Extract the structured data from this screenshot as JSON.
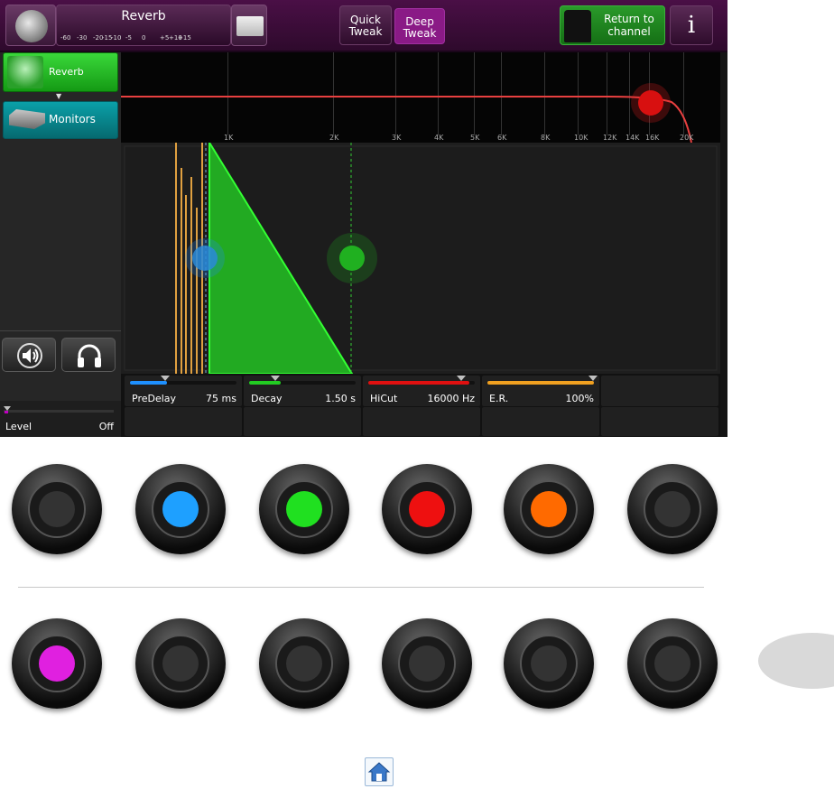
{
  "topbar": {
    "preset_title": "Reverb",
    "scale_ticks": [
      "-60",
      "-30",
      "-20",
      "-15",
      "-10",
      "-5",
      "0",
      "+5",
      "+10",
      "+15"
    ],
    "quick_tweak_line1": "Quick",
    "quick_tweak_line2": "Tweak",
    "deep_tweak_line1": "Deep",
    "deep_tweak_line2": "Tweak",
    "return_line1": "Return to",
    "return_line2": "channel",
    "info_label": "i"
  },
  "sidebar": {
    "reverb_label": "Reverb",
    "monitors_label": "Monitors",
    "level_label": "Level",
    "level_value": "Off"
  },
  "eq": {
    "freq_labels": [
      "1K",
      "2K",
      "3K",
      "4K",
      "5K",
      "6K",
      "8K",
      "10K",
      "12K",
      "14K",
      "16K",
      "20K"
    ]
  },
  "params": [
    {
      "label": "PreDelay",
      "value": "75 ms",
      "color": "#1e90ff",
      "level": 0.35
    },
    {
      "label": "Decay",
      "value": "1.50 s",
      "color": "#22cc22",
      "level": 0.3
    },
    {
      "label": "HiCut",
      "value": "16000 Hz",
      "color": "#e01010",
      "level": 0.95
    },
    {
      "label": "E.R.",
      "value": "100%",
      "color": "#f0a020",
      "level": 1.0
    }
  ],
  "knobs_row1": [
    {
      "name": "knob-1",
      "color": "#333333"
    },
    {
      "name": "knob-2",
      "color": "#1ea0ff"
    },
    {
      "name": "knob-3",
      "color": "#20e020"
    },
    {
      "name": "knob-4",
      "color": "#ee1010"
    },
    {
      "name": "knob-5",
      "color": "#ff6a00"
    },
    {
      "name": "knob-6",
      "color": "#333333"
    }
  ],
  "knobs_row2": [
    {
      "name": "knob-7",
      "color": "#e020e0"
    },
    {
      "name": "knob-8",
      "color": "#333333"
    },
    {
      "name": "knob-9",
      "color": "#333333"
    },
    {
      "name": "knob-10",
      "color": "#333333"
    },
    {
      "name": "knob-11",
      "color": "#333333"
    },
    {
      "name": "knob-12",
      "color": "#333333"
    }
  ],
  "icons": {
    "logo": "globe-logo-icon",
    "folder": "folder-icon",
    "info": "info-icon",
    "speaker": "speaker-icon",
    "headphones": "headphones-icon",
    "home": "home-icon"
  }
}
